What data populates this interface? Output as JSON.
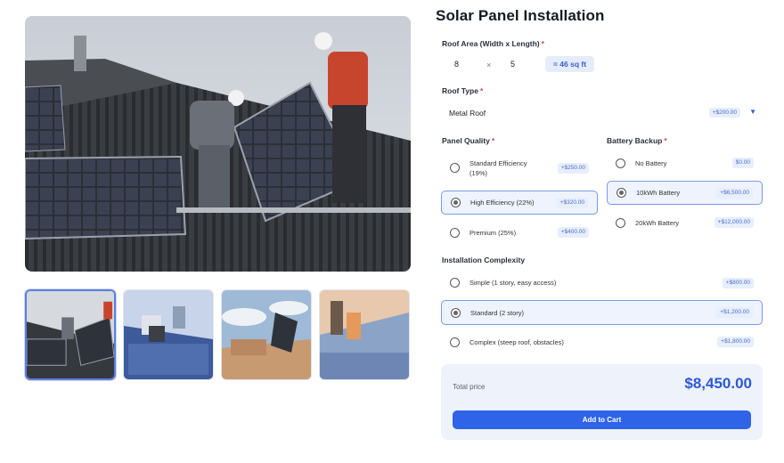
{
  "product": {
    "title": "Solar Panel Installation"
  },
  "roof_area": {
    "label": "Roof Area (Width x Length)",
    "required_mark": "*",
    "width": "8",
    "times": "×",
    "length": "5",
    "result": "= 46 sq ft"
  },
  "roof_type": {
    "label": "Roof Type",
    "required_mark": "*",
    "selected": "Metal Roof",
    "price": "+$200.00",
    "arrow": "▼"
  },
  "panel_quality": {
    "label": "Panel Quality",
    "required_mark": "*",
    "options": [
      {
        "label": "Standard Efficiency (19%)",
        "price": "+$250.00",
        "selected": false
      },
      {
        "label": "High Efficiency (22%)",
        "price": "+$320.00",
        "selected": true
      },
      {
        "label": "Premium (25%)",
        "price": "+$400.00",
        "selected": false
      }
    ]
  },
  "battery_backup": {
    "label": "Battery Backup",
    "required_mark": "*",
    "options": [
      {
        "label": "No Battery",
        "price": "$0.00",
        "selected": false
      },
      {
        "label": "10kWh Battery",
        "price": "+$6,500.00",
        "selected": true
      },
      {
        "label": "20kWh Battery",
        "price": "+$12,000.00",
        "selected": false
      }
    ]
  },
  "installation_complexity": {
    "label": "Installation Complexity",
    "options": [
      {
        "label": "Simple (1 story, easy access)",
        "price": "+$800.00",
        "selected": false
      },
      {
        "label": "Standard (2 story)",
        "price": "+$1,200.00",
        "selected": true
      },
      {
        "label": "Complex (steep roof, obstacles)",
        "price": "+$1,800.00",
        "selected": false
      }
    ]
  },
  "summary": {
    "total_label": "Total price",
    "total_value": "$8,450.00",
    "cart_button": "Add to Cart"
  },
  "gallery": {
    "thumbnails": [
      {
        "name": "thumb-1",
        "active": true
      },
      {
        "name": "thumb-2",
        "active": false
      },
      {
        "name": "thumb-3",
        "active": false
      },
      {
        "name": "thumb-4",
        "active": false
      }
    ]
  },
  "colors": {
    "accent": "#2f63e8",
    "price_badge_bg": "#e7eefc",
    "selected_border": "#7b9be4",
    "required": "#d54848"
  }
}
